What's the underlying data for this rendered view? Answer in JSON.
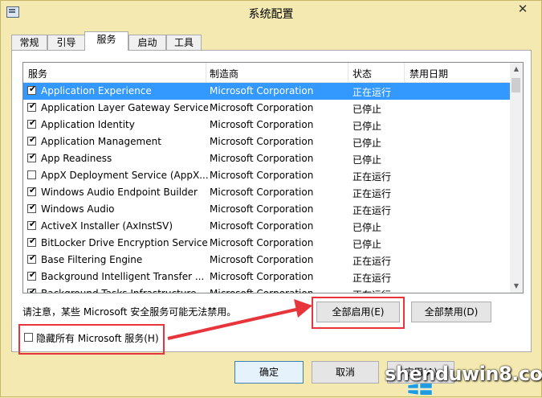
{
  "window": {
    "title": "系统配置",
    "close_label": "✕"
  },
  "tabs": [
    {
      "label": "常规",
      "active": false
    },
    {
      "label": "引导",
      "active": false
    },
    {
      "label": "服务",
      "active": true
    },
    {
      "label": "启动",
      "active": false
    },
    {
      "label": "工具",
      "active": false
    }
  ],
  "services": {
    "columns": [
      "服务",
      "制造商",
      "状态",
      "禁用日期"
    ],
    "rows": [
      {
        "name": "Application Experience",
        "maker": "Microsoft Corporation",
        "status": "正在运行",
        "date": "",
        "checked": true,
        "selected": true
      },
      {
        "name": "Application Layer Gateway Service",
        "maker": "Microsoft Corporation",
        "status": "已停止",
        "date": "",
        "checked": true,
        "selected": false
      },
      {
        "name": "Application Identity",
        "maker": "Microsoft Corporation",
        "status": "已停止",
        "date": "",
        "checked": true,
        "selected": false
      },
      {
        "name": "Application Management",
        "maker": "Microsoft Corporation",
        "status": "已停止",
        "date": "",
        "checked": true,
        "selected": false
      },
      {
        "name": "App Readiness",
        "maker": "Microsoft Corporation",
        "status": "已停止",
        "date": "",
        "checked": true,
        "selected": false
      },
      {
        "name": "AppX Deployment Service (AppX...",
        "maker": "Microsoft Corporation",
        "status": "正在运行",
        "date": "",
        "checked": false,
        "selected": false
      },
      {
        "name": "Windows Audio Endpoint Builder",
        "maker": "Microsoft Corporation",
        "status": "正在运行",
        "date": "",
        "checked": true,
        "selected": false
      },
      {
        "name": "Windows Audio",
        "maker": "Microsoft Corporation",
        "status": "正在运行",
        "date": "",
        "checked": true,
        "selected": false
      },
      {
        "name": "ActiveX Installer (AxInstSV)",
        "maker": "Microsoft Corporation",
        "status": "已停止",
        "date": "",
        "checked": true,
        "selected": false
      },
      {
        "name": "BitLocker Drive Encryption Service",
        "maker": "Microsoft Corporation",
        "status": "已停止",
        "date": "",
        "checked": true,
        "selected": false
      },
      {
        "name": "Base Filtering Engine",
        "maker": "Microsoft Corporation",
        "status": "正在运行",
        "date": "",
        "checked": true,
        "selected": false
      },
      {
        "name": "Background Intelligent Transfer ...",
        "maker": "Microsoft Corporation",
        "status": "正在运行",
        "date": "",
        "checked": true,
        "selected": false
      },
      {
        "name": "Background Tasks Infrastructure ...",
        "maker": "Microsoft Corporation",
        "status": "正在运行",
        "date": "",
        "checked": true,
        "selected": false
      }
    ]
  },
  "note": "请注意，某些 Microsoft 安全服务可能无法禁用。",
  "buttons": {
    "enable_all": "全部启用(E)",
    "disable_all": "全部禁用(D)"
  },
  "hide_ms": {
    "label": "隐藏所有 Microsoft 服务(H)",
    "checked": false
  },
  "dialog_buttons": {
    "ok": "确定",
    "cancel": "取消",
    "apply": "应用(A)"
  },
  "watermark": "shenduwin8.com",
  "colors": {
    "annotation": "#e8353b",
    "selection": "#3399ff",
    "frame": "#f4e9b0"
  }
}
